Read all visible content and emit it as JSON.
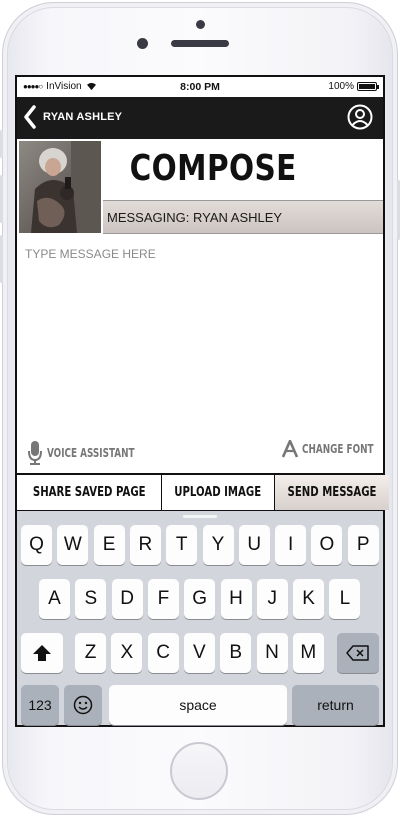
{
  "status_bar": {
    "carrier": "InVision",
    "time": "8:00 PM",
    "battery": "100%"
  },
  "nav": {
    "contact_name": "RYAN ASHLEY",
    "back_icon": "chevron-left-icon",
    "profile_icon": "user-circle-icon"
  },
  "compose": {
    "title": "COMPOSE",
    "messaging_label": "MESSAGING: RYAN ASHLEY"
  },
  "message": {
    "placeholder": "TYPE MESSAGE HERE",
    "value": ""
  },
  "tools": {
    "voice_assistant": "VOICE ASSISTANT",
    "change_font": "CHANGE FONT"
  },
  "actions": {
    "share": "SHARE SAVED PAGE",
    "upload": "UPLOAD IMAGE",
    "send": "SEND MESSAGE"
  },
  "keyboard": {
    "row1": [
      "Q",
      "W",
      "E",
      "R",
      "T",
      "Y",
      "U",
      "I",
      "O",
      "P"
    ],
    "row2": [
      "A",
      "S",
      "D",
      "F",
      "G",
      "H",
      "J",
      "K",
      "L"
    ],
    "row3": [
      "Z",
      "X",
      "C",
      "V",
      "B",
      "N",
      "M"
    ],
    "numbers": "123",
    "space": "space",
    "return": "return",
    "shift_icon": "shift-arrow-icon",
    "delete_icon": "backspace-icon",
    "emoji_icon": "emoji-icon"
  },
  "colors": {
    "nav_bg": "#1a1a1a",
    "keyboard_bg": "#d2d5db",
    "accent_gradient": "#d7d0cc"
  }
}
